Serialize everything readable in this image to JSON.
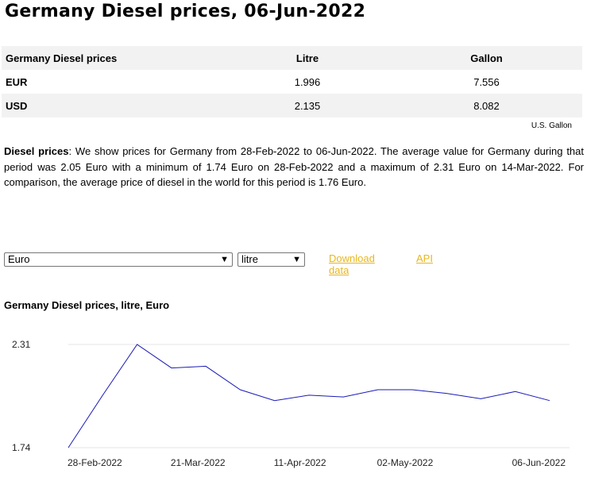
{
  "page_title": "Germany Diesel prices, 06-Jun-2022",
  "table": {
    "headers": [
      "Germany Diesel prices",
      "Litre",
      "Gallon"
    ],
    "rows": [
      [
        "EUR",
        "1.996",
        "7.556"
      ],
      [
        "USD",
        "2.135",
        "8.082"
      ]
    ],
    "footnote": "U.S. Gallon"
  },
  "description": {
    "label": "Diesel prices",
    "text": ": We show prices for Germany from 28-Feb-2022 to 06-Jun-2022. The average value for Germany during that period was 2.05 Euro with a minimum of 1.74 Euro on 28-Feb-2022 and a maximum of 2.31 Euro on 14-Mar-2022. For comparison, the average price of diesel in the world for this period is 1.76 Euro."
  },
  "controls": {
    "currency_select": "Euro",
    "unit_select": "litre",
    "download_link": "Download data",
    "api_link": "API"
  },
  "colors": {
    "line": "#1a1ab8",
    "link": "#e8b61e",
    "grid": "#e6e6e6"
  },
  "chart_data": {
    "type": "line",
    "title": "Germany Diesel prices, litre, Euro",
    "x": [
      "28-Feb-2022",
      "07-Mar-2022",
      "14-Mar-2022",
      "21-Mar-2022",
      "28-Mar-2022",
      "04-Apr-2022",
      "11-Apr-2022",
      "18-Apr-2022",
      "25-Apr-2022",
      "02-May-2022",
      "09-May-2022",
      "16-May-2022",
      "23-May-2022",
      "30-May-2022",
      "06-Jun-2022"
    ],
    "series": [
      {
        "values": [
          1.74,
          2.03,
          2.31,
          2.18,
          2.19,
          2.06,
          2.0,
          2.03,
          2.02,
          2.06,
          2.06,
          2.04,
          2.01,
          2.05,
          2.0
        ]
      }
    ],
    "x_tick_labels": [
      "28-Feb-2022",
      "21-Mar-2022",
      "11-Apr-2022",
      "02-May-2022",
      "06-Jun-2022"
    ],
    "y_tick_labels": [
      "2.31",
      "1.74"
    ],
    "ylim": [
      1.74,
      2.31
    ],
    "grid": true,
    "legend": "none"
  }
}
